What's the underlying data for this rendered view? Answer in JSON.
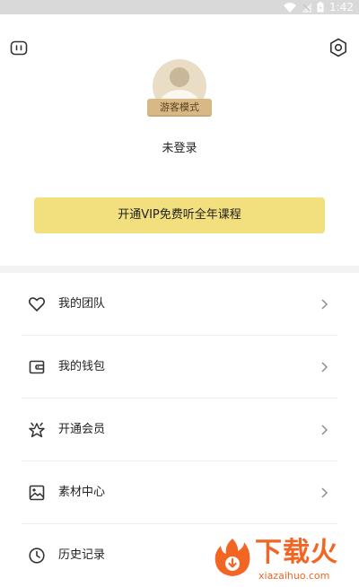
{
  "statusbar": {
    "time": "1:42"
  },
  "profile": {
    "badge": "游客模式",
    "username": "未登录"
  },
  "vip_banner": {
    "label": "开通VIP免费听全年课程"
  },
  "menu": {
    "items": [
      {
        "label": "我的团队",
        "icon": "heart-icon"
      },
      {
        "label": "我的钱包",
        "icon": "wallet-icon"
      },
      {
        "label": "开通会员",
        "icon": "crown-icon"
      },
      {
        "label": "素材中心",
        "icon": "image-icon"
      },
      {
        "label": "历史记录",
        "icon": "clock-icon"
      }
    ]
  },
  "watermark": {
    "title": "下载火",
    "url": "xiazaihuo.com"
  },
  "colors": {
    "accent": "#f2df7d",
    "badge": "#d8b985",
    "watermark": "#f26522"
  }
}
